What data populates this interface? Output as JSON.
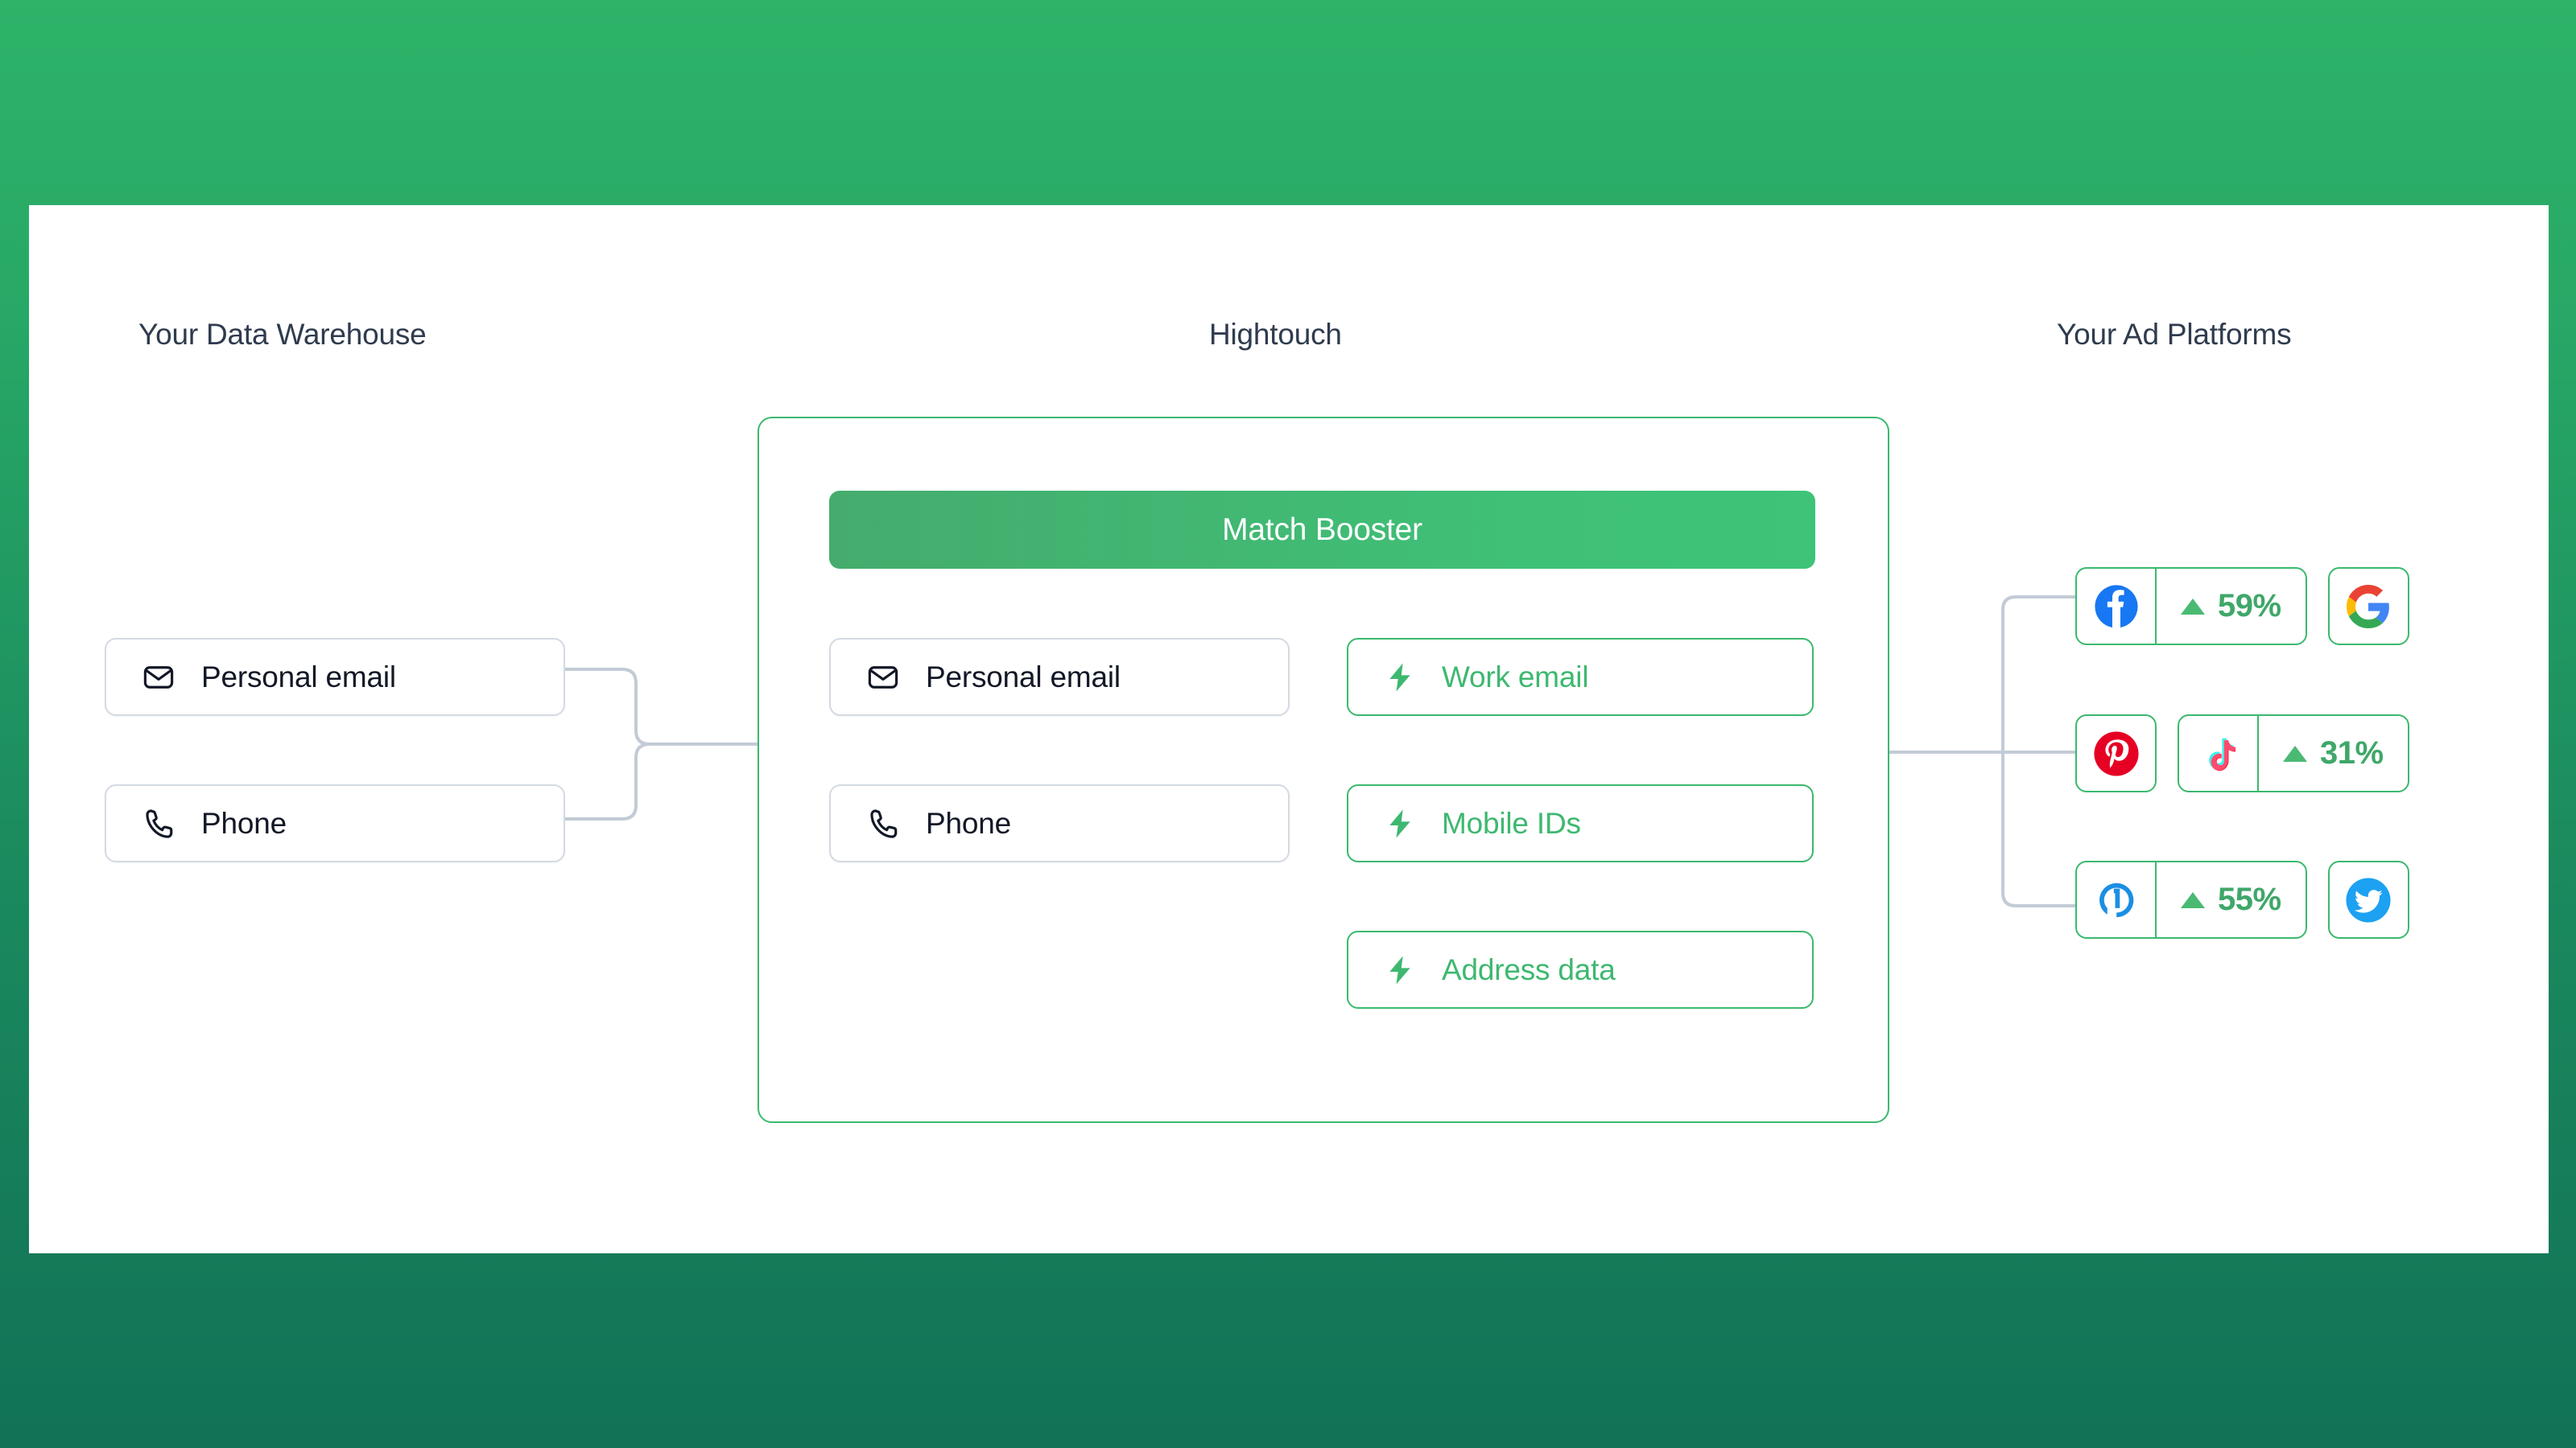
{
  "theme": {
    "background_gradient_top": "#2eb369",
    "background_gradient_bottom": "#117256",
    "card_background": "#ffffff",
    "accent_green": "#3bb96e",
    "green_text": "#3eb870",
    "heading_text": "#2f3b4e",
    "grey_border": "#d4dae2",
    "connector_line": "#c2cbd6"
  },
  "columns": {
    "warehouse": {
      "heading": "Your Data Warehouse",
      "identifiers": [
        {
          "label": "Personal email",
          "icon": "envelope-icon"
        },
        {
          "label": "Phone",
          "icon": "phone-icon"
        }
      ]
    },
    "hightouch": {
      "heading": "Hightouch",
      "banner_label": "Match Booster",
      "input_identifiers": [
        {
          "label": "Personal email",
          "icon": "envelope-icon"
        },
        {
          "label": "Phone",
          "icon": "phone-icon"
        }
      ],
      "enriched_identifiers": [
        {
          "label": "Work email",
          "icon": "lightning-bolt-icon"
        },
        {
          "label": "Mobile IDs",
          "icon": "lightning-bolt-icon"
        },
        {
          "label": "Address data",
          "icon": "lightning-bolt-icon"
        }
      ]
    },
    "ad_platforms": {
      "heading": "Your Ad Platforms",
      "rows": [
        {
          "badges": [
            {
              "platform": "Facebook",
              "icon": "facebook-icon",
              "has_stat": true,
              "trend": "up",
              "value": "59%"
            },
            {
              "platform": "Google",
              "icon": "google-icon",
              "has_stat": false
            }
          ]
        },
        {
          "badges": [
            {
              "platform": "Pinterest",
              "icon": "pinterest-icon",
              "has_stat": false
            },
            {
              "platform": "TikTok",
              "icon": "tiktok-icon",
              "has_stat": true,
              "trend": "up",
              "value": "31%"
            }
          ]
        },
        {
          "badges": [
            {
              "platform": "The Trade Desk",
              "icon": "trade-desk-icon",
              "has_stat": true,
              "trend": "up",
              "value": "55%"
            },
            {
              "platform": "Twitter",
              "icon": "twitter-icon",
              "has_stat": false
            }
          ]
        }
      ]
    }
  }
}
